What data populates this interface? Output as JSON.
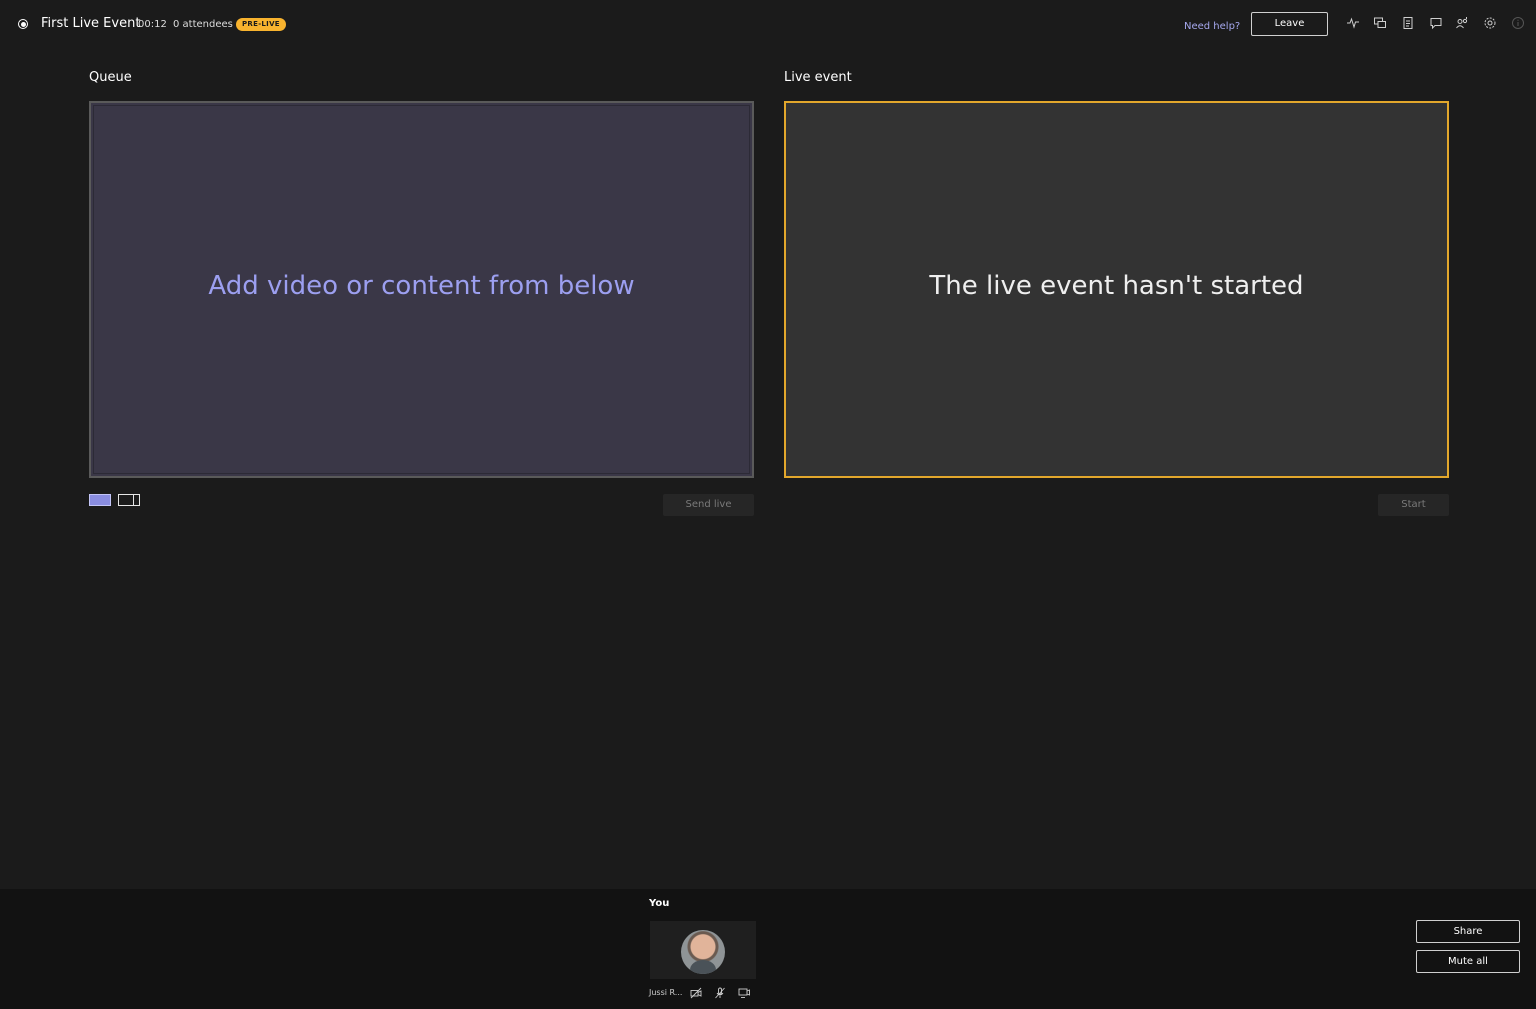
{
  "header": {
    "event_title": "First Live Event",
    "timer": "00:12",
    "attendees": "0 attendees",
    "status_badge": "PRE-LIVE",
    "help_link": "Need help?",
    "leave_label": "Leave",
    "toolbar_icons": [
      "health-icon",
      "qna-icon",
      "notes-icon",
      "chat-icon",
      "people-icon",
      "settings-icon",
      "info-icon"
    ]
  },
  "queue": {
    "label": "Queue",
    "placeholder": "Add video or content from below",
    "send_live_label": "Send live",
    "layouts": [
      "single-layout",
      "split-layout"
    ]
  },
  "live_event": {
    "label": "Live event",
    "status_text": "The live event hasn't started",
    "start_label": "Start"
  },
  "participants": {
    "section_label": "You",
    "items": [
      {
        "name": "Jussi R...",
        "icons": [
          "camera-off-icon",
          "mic-off-icon",
          "screen-share-icon"
        ]
      }
    ]
  },
  "actions": {
    "share_label": "Share",
    "mute_all_label": "Mute all"
  },
  "colors": {
    "background": "#1b1b1b",
    "accent": "#8a8de0",
    "live_border": "#e2a72c",
    "badge": "#f8b32e"
  }
}
